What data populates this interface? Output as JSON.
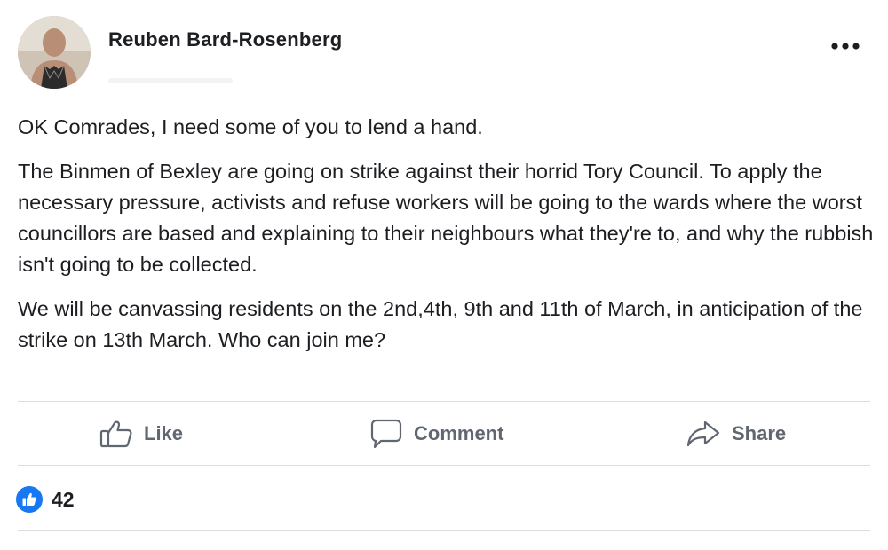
{
  "post": {
    "author_name": "Reuben Bard-Rosenberg",
    "paragraphs": [
      "OK Comrades, I need some of you to lend a hand.",
      "The Binmen of Bexley are going on strike against their horrid Tory Council. To apply the necessary pressure, activists and refuse workers will be going to the wards where the worst councillors are based and explaining to their neighbours what they're to, and why the rubbish isn't going to be collected.",
      "We will be canvassing residents on the 2nd,4th, 9th and 11th of March, in anticipation of the strike on 13th March. Who can join me?"
    ]
  },
  "actions": {
    "like_label": "Like",
    "comment_label": "Comment",
    "share_label": "Share"
  },
  "reactions": {
    "like_count": "42"
  },
  "icons": {
    "more": "more-options-icon",
    "like": "thumbs-up-icon",
    "comment": "comment-bubble-icon",
    "share": "share-arrow-icon",
    "reaction": "like-reaction-icon"
  },
  "colors": {
    "reaction_blue": "#1877f2",
    "action_gray": "#606770",
    "divider": "#dadde1",
    "text": "#1c1e21"
  }
}
